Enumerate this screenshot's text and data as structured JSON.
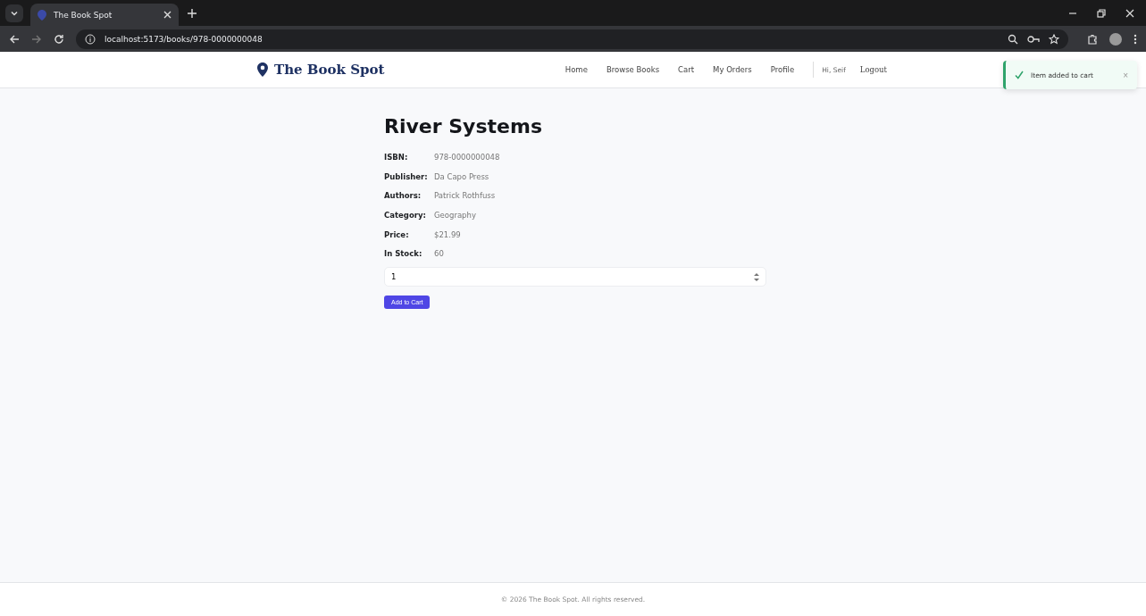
{
  "browser": {
    "tab_title": "The Book Spot",
    "url": "localhost:5173/books/978-0000000048"
  },
  "header": {
    "logo": "The Book Spot",
    "nav": [
      {
        "label": "Home"
      },
      {
        "label": "Browse Books"
      },
      {
        "label": "Cart"
      },
      {
        "label": "My Orders"
      },
      {
        "label": "Profile"
      }
    ],
    "greeting": "Hi, Seif",
    "logout": "Logout"
  },
  "toast": {
    "message": "Item added to cart",
    "close": "×"
  },
  "book": {
    "title": "River Systems",
    "details": [
      {
        "label": "ISBN:",
        "value": "978-0000000048"
      },
      {
        "label": "Publisher:",
        "value": "Da Capo Press"
      },
      {
        "label": "Authors:",
        "value": "Patrick Rothfuss"
      },
      {
        "label": "Category:",
        "value": "Geography"
      },
      {
        "label": "Price:",
        "value": "$21.99"
      },
      {
        "label": "In Stock:",
        "value": "60"
      }
    ],
    "quantity": "1",
    "add_button": "Add to Cart"
  },
  "footer": "© 2026 The Book Spot. All rights reserved."
}
